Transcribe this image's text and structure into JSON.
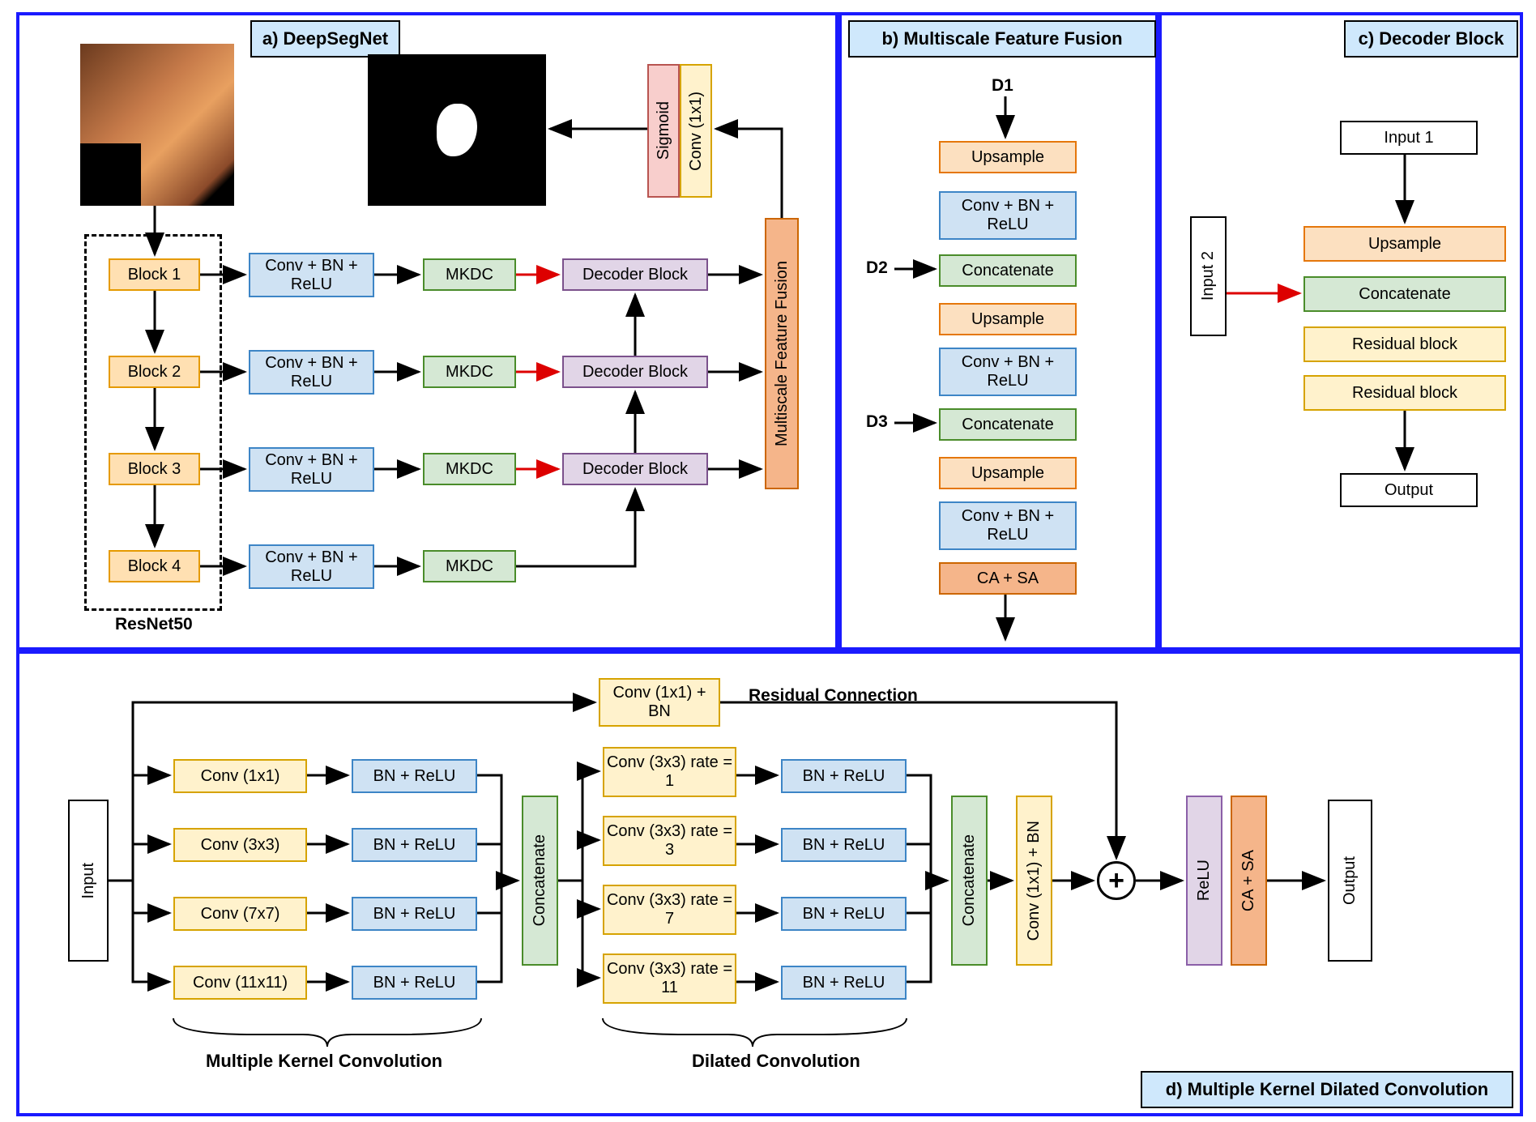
{
  "panels": {
    "a": {
      "title": "a) DeepSegNet"
    },
    "b": {
      "title": "b) Multiscale Feature Fusion"
    },
    "c": {
      "title": "c) Decoder Block"
    },
    "d": {
      "title": "d) Multiple Kernel Dilated Convolution"
    }
  },
  "a": {
    "resnet_label": "ResNet50",
    "blocks": [
      "Block 1",
      "Block 2",
      "Block 3",
      "Block 4"
    ],
    "conv_bn_relu": "Conv + BN + ReLU",
    "mkdc": "MKDC",
    "decoder": "Decoder Block",
    "mff": "Multiscale Feature Fusion",
    "sigmoid": "Sigmoid",
    "conv1x1": "Conv (1x1)"
  },
  "b": {
    "d1": "D1",
    "d2": "D2",
    "d3": "D3",
    "upsample": "Upsample",
    "cbr": "Conv + BN + ReLU",
    "concat": "Concatenate",
    "casa": "CA + SA"
  },
  "c": {
    "input1": "Input 1",
    "input2": "Input 2",
    "upsample": "Upsample",
    "concat": "Concatenate",
    "resblock": "Residual block",
    "output": "Output"
  },
  "d": {
    "input": "Input",
    "output": "Output",
    "residual": "Residual Connection",
    "conv1x1bn": "Conv (1x1) + BN",
    "conv1x1bn_v": "Conv (1x1) + BN",
    "mkc": [
      "Conv (1x1)",
      "Conv (3x3)",
      "Conv (7x7)",
      "Conv (11x11)"
    ],
    "bnrelu": "BN + ReLU",
    "concat": "Concatenate",
    "dc": [
      "Conv (3x3) rate = 1",
      "Conv (3x3) rate = 3",
      "Conv (3x3) rate = 7",
      "Conv (3x3) rate = 11"
    ],
    "relu": "ReLU",
    "casa": "CA + SA",
    "mkc_label": "Multiple Kernel Convolution",
    "dc_label": "Dilated Convolution"
  }
}
